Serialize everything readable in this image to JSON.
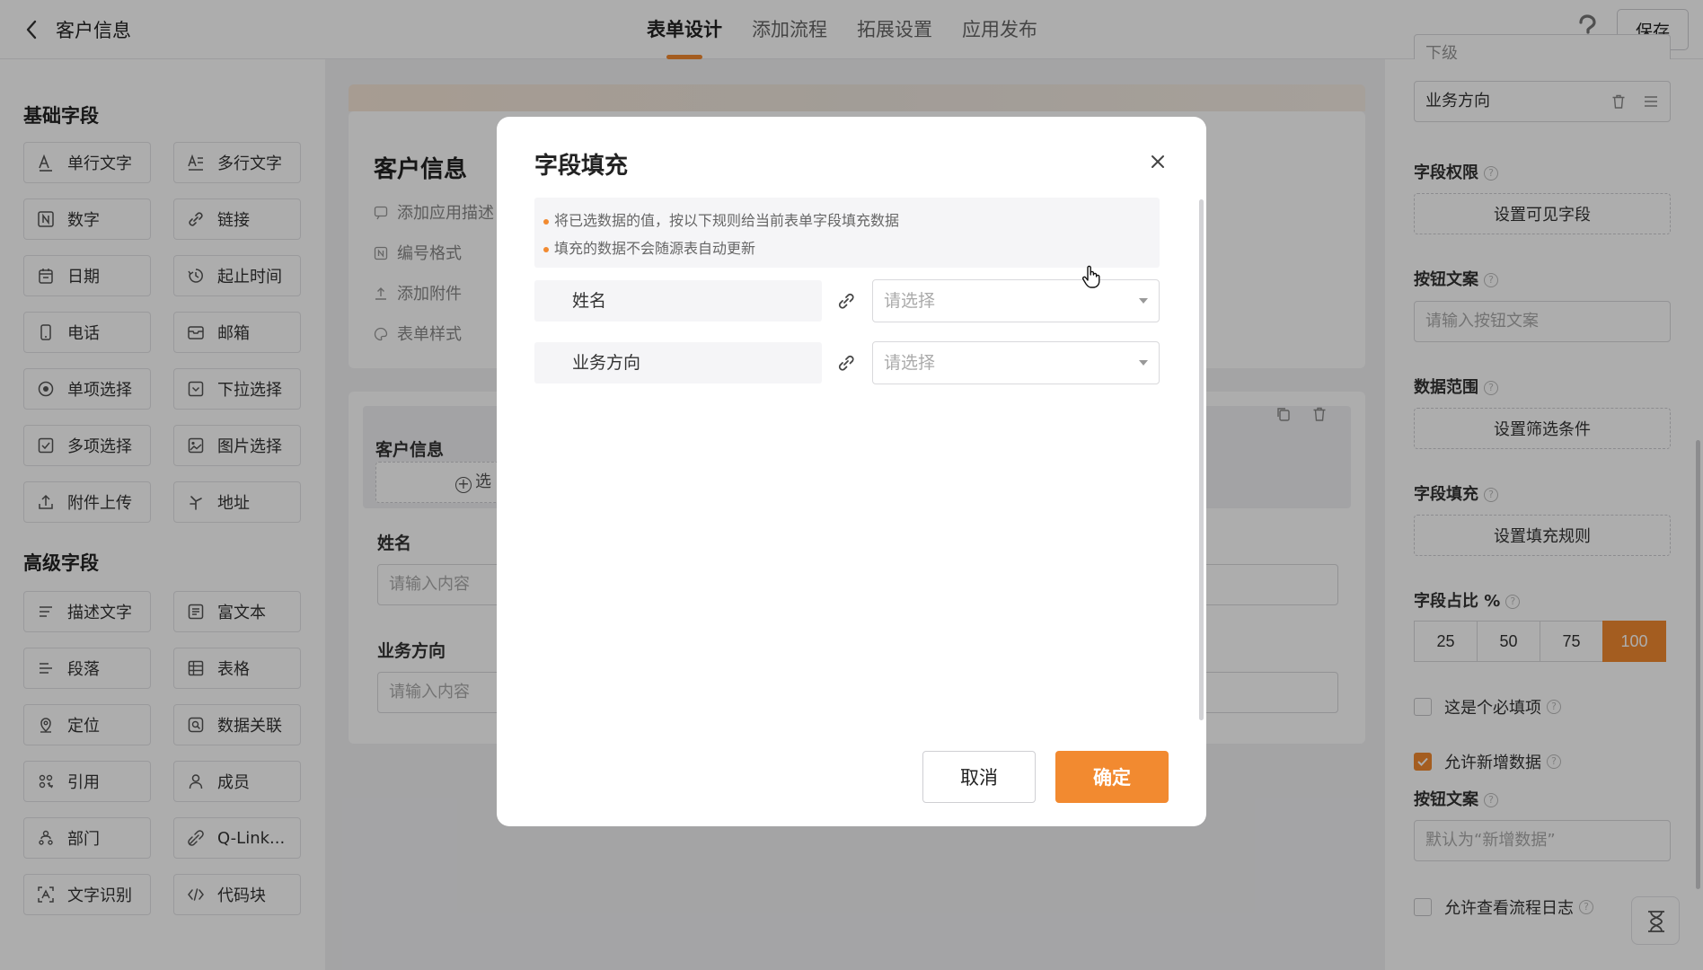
{
  "topbar": {
    "title": "客户信息",
    "tabs": [
      "表单设计",
      "添加流程",
      "拓展设置",
      "应用发布"
    ],
    "active_tab": "表单设计",
    "help_icon": "question-icon",
    "save_label": "保存"
  },
  "left_panel": {
    "basic_title": "基础字段",
    "basic_fields": [
      {
        "label": "单行文字",
        "icon": "single-line-text-icon"
      },
      {
        "label": "多行文字",
        "icon": "multi-line-text-icon"
      },
      {
        "label": "数字",
        "icon": "number-icon"
      },
      {
        "label": "链接",
        "icon": "link-icon"
      },
      {
        "label": "日期",
        "icon": "calendar-icon"
      },
      {
        "label": "起止时间",
        "icon": "time-range-icon"
      },
      {
        "label": "电话",
        "icon": "phone-icon"
      },
      {
        "label": "邮箱",
        "icon": "mail-icon"
      },
      {
        "label": "单项选择",
        "icon": "radio-icon"
      },
      {
        "label": "下拉选择",
        "icon": "dropdown-icon"
      },
      {
        "label": "多项选择",
        "icon": "checkbox-icon"
      },
      {
        "label": "图片选择",
        "icon": "image-icon"
      },
      {
        "label": "附件上传",
        "icon": "upload-icon"
      },
      {
        "label": "地址",
        "icon": "location-pin-icon"
      }
    ],
    "advanced_title": "高级字段",
    "advanced_fields": [
      {
        "label": "描述文字",
        "icon": "description-icon"
      },
      {
        "label": "富文本",
        "icon": "rich-text-icon"
      },
      {
        "label": "段落",
        "icon": "paragraph-icon"
      },
      {
        "label": "表格",
        "icon": "table-icon"
      },
      {
        "label": "定位",
        "icon": "locate-icon"
      },
      {
        "label": "数据关联",
        "icon": "data-link-icon"
      },
      {
        "label": "引用",
        "icon": "reference-icon"
      },
      {
        "label": "成员",
        "icon": "user-icon"
      },
      {
        "label": "部门",
        "icon": "department-icon"
      },
      {
        "label": "Q-Link...",
        "icon": "qlink-icon"
      },
      {
        "label": "文字识别",
        "icon": "ocr-icon"
      },
      {
        "label": "代码块",
        "icon": "code-icon"
      }
    ]
  },
  "canvas": {
    "form_title": "客户信息",
    "form_links": [
      "添加应用描述",
      "编号格式",
      "添加附件",
      "表单样式"
    ],
    "group_title": "客户信息",
    "group_add_label": "选",
    "fields": [
      {
        "label": "姓名",
        "placeholder": "请输入内容"
      },
      {
        "label": "业务方向",
        "placeholder": "请输入内容"
      }
    ]
  },
  "right_panel": {
    "cut_row": "下级",
    "list_item": "业务方向",
    "field_permission_label": "字段权限",
    "field_permission_button": "设置可见字段",
    "button_text_label": "按钮文案",
    "button_text_placeholder": "请输入按钮文案",
    "data_range_label": "数据范围",
    "data_range_button": "设置筛选条件",
    "field_fill_label": "字段填充",
    "field_fill_button": "设置填充规则",
    "ratio_label": "字段占比 %",
    "ratio_options": [
      "25",
      "50",
      "75",
      "100"
    ],
    "ratio_selected": "100",
    "required_label": "这是个必填项",
    "required_checked": false,
    "allow_add_label": "允许新增数据",
    "allow_add_checked": true,
    "add_button_text_label": "按钮文案",
    "add_button_text_placeholder": "默认为“新增数据”",
    "allow_log_label": "允许查看流程日志",
    "allow_log_checked": false
  },
  "modal": {
    "title": "字段填充",
    "notices": [
      "将已选数据的值，按以下规则给当前表单字段填充数据",
      "填充的数据不会随源表自动更新"
    ],
    "mappings": [
      {
        "field": "姓名",
        "placeholder": "请选择"
      },
      {
        "field": "业务方向",
        "placeholder": "请选择"
      }
    ],
    "cancel_label": "取消",
    "confirm_label": "确定"
  },
  "colors": {
    "accent": "#f28a30",
    "overlay": "rgba(0,0,0,0.32)"
  }
}
